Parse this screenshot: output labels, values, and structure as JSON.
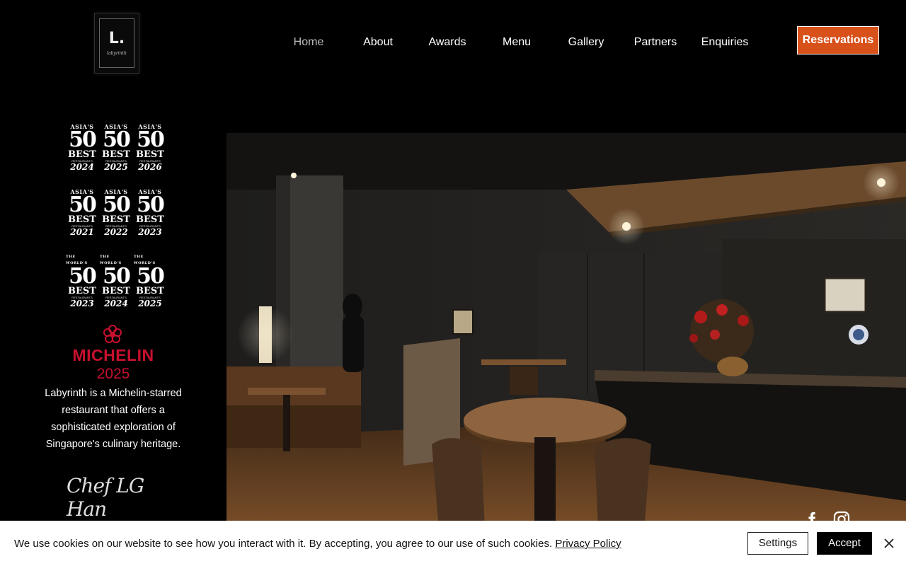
{
  "brand": {
    "logo_mark": "L.",
    "logo_script": "labyrinth"
  },
  "nav": {
    "items": [
      {
        "label": "Home",
        "active": true
      },
      {
        "label": "About"
      },
      {
        "label": "Awards"
      },
      {
        "label": "Menu"
      },
      {
        "label": "Gallery"
      },
      {
        "label": "Partners"
      },
      {
        "label": "Enquiries"
      }
    ],
    "reservations_label": "Reservations"
  },
  "awards": [
    {
      "top": "ASIA'S",
      "num": "50",
      "best": "BEST",
      "year": "2024",
      "small": "RESTAURANTS"
    },
    {
      "top": "ASIA'S",
      "num": "50",
      "best": "BEST",
      "year": "2025",
      "small": "RESTAURANTS"
    },
    {
      "top": "ASIA'S",
      "num": "50",
      "best": "BEST",
      "year": "2026",
      "small": "RESTAURANTS"
    },
    {
      "top": "ASIA'S",
      "num": "50",
      "best": "BEST",
      "year": "2021",
      "small": "RESTAURANTS"
    },
    {
      "top": "ASIA'S",
      "num": "50",
      "best": "BEST",
      "year": "2022",
      "small": "RESTAURANTS"
    },
    {
      "top": "ASIA'S",
      "num": "50",
      "best": "BEST",
      "year": "2023",
      "small": "RESTAURANTS"
    },
    {
      "top": "THE WORLD'S",
      "num": "50",
      "best": "BEST",
      "year": "2023",
      "small": "RESTAURANTS"
    },
    {
      "top": "THE WORLD'S",
      "num": "50",
      "best": "BEST",
      "year": "2024",
      "small": "RESTAURANTS"
    },
    {
      "top": "THE WORLD'S",
      "num": "50",
      "best": "BEST",
      "year": "2025",
      "small": "RESTAURANTS"
    }
  ],
  "michelin": {
    "word": "MICHELIN",
    "year": "2025",
    "color": "#c8102e"
  },
  "description": "Labyrinth is a Michelin-starred restaurant that offers a sophisticated exploration of Singapore's culinary heritage.",
  "signature": "Chef LG Han",
  "social": {
    "icons": [
      "facebook-icon",
      "instagram-icon"
    ]
  },
  "cookie": {
    "text": "We use cookies on our website to see how you interact with it. By accepting, you agree to our use of such cookies.",
    "link": "Privacy Policy",
    "settings_label": "Settings",
    "accept_label": "Accept"
  },
  "colors": {
    "accent": "#d8501a",
    "background": "#000000"
  }
}
